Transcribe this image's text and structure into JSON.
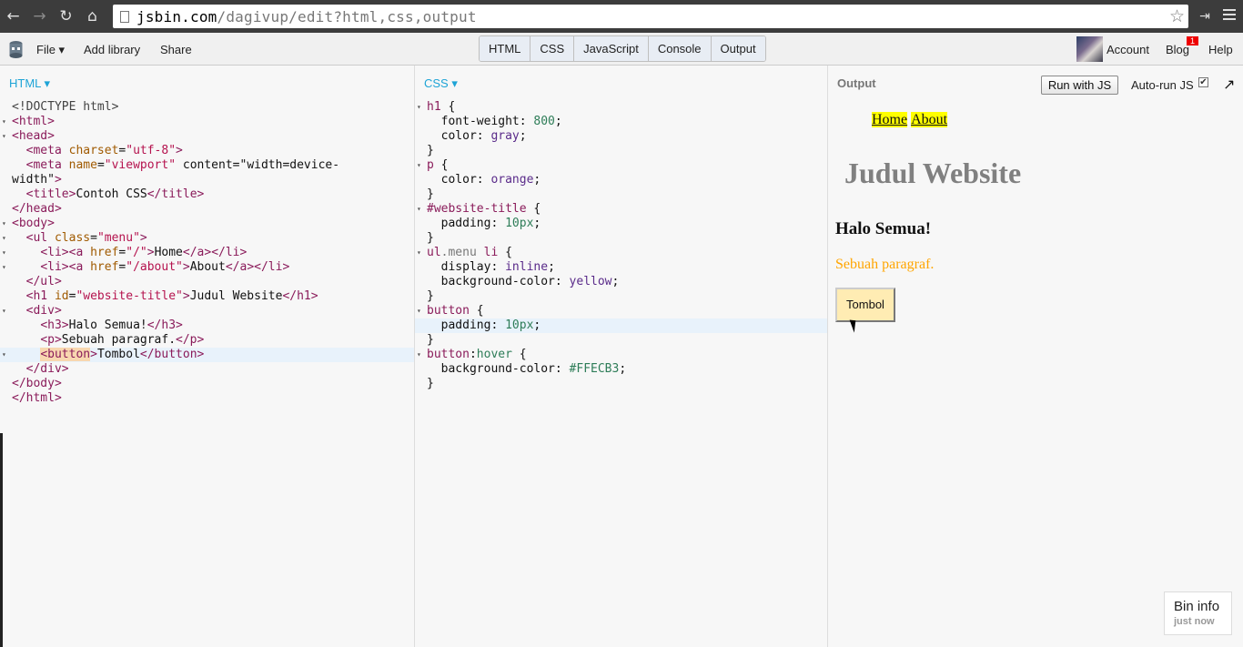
{
  "browser": {
    "url_host": "jsbin.com",
    "url_path": "/dagivup/edit?html,css,output"
  },
  "toolbar": {
    "file": "File ▾",
    "add_library": "Add library",
    "share": "Share",
    "tabs": [
      "HTML",
      "CSS",
      "JavaScript",
      "Console",
      "Output"
    ],
    "account": "Account",
    "blog": "Blog",
    "blog_badge": "1",
    "help": "Help"
  },
  "html_panel": {
    "label": "HTML ▾",
    "lines": [
      "<!DOCTYPE html>",
      "<html>",
      "<head>",
      "  <meta charset=\"utf-8\">",
      "  <meta name=\"viewport\" content=\"width=device-",
      "width\">",
      "  <title>Contoh CSS</title>",
      "</head>",
      "<body>",
      "  <ul class=\"menu\">",
      "    <li><a href=\"/\">Home</a></li>",
      "    <li><a href=\"/about\">About</a></li>",
      "  </ul>",
      "  <h1 id=\"website-title\">Judul Website</h1>",
      "  <div>",
      "    <h3>Halo Semua!</h3>",
      "    <p>Sebuah paragraf.</p>",
      "    <button>Tombol</button>",
      "  </div>",
      "</body>",
      "</html>"
    ]
  },
  "css_panel": {
    "label": "CSS ▾",
    "lines": [
      "h1 {",
      "  font-weight: 800;",
      "  color: gray;",
      "}",
      "p {",
      "  color: orange;",
      "}",
      "#website-title {",
      "  padding: 10px;",
      "}",
      "ul.menu li {",
      "  display: inline;",
      "  background-color: yellow;",
      "}",
      "button {",
      "  padding: 10px;",
      "}",
      "button:hover {",
      "  background-color: #FFECB3;",
      "}"
    ]
  },
  "output_panel": {
    "label": "Output",
    "run_button": "Run with JS",
    "autorun_label": "Auto-run JS",
    "autorun_checked": true,
    "nav_links": [
      "Home",
      "About"
    ],
    "h1": "Judul Website",
    "h3": "Halo Semua!",
    "paragraph": "Sebuah paragraf.",
    "button": "Tombol"
  },
  "bin_info": {
    "title": "Bin info",
    "subtitle": "just now"
  },
  "colors": {
    "accent": "#1ea4d6",
    "button_hover_bg": "#FFECB3",
    "menu_bg": "yellow"
  }
}
